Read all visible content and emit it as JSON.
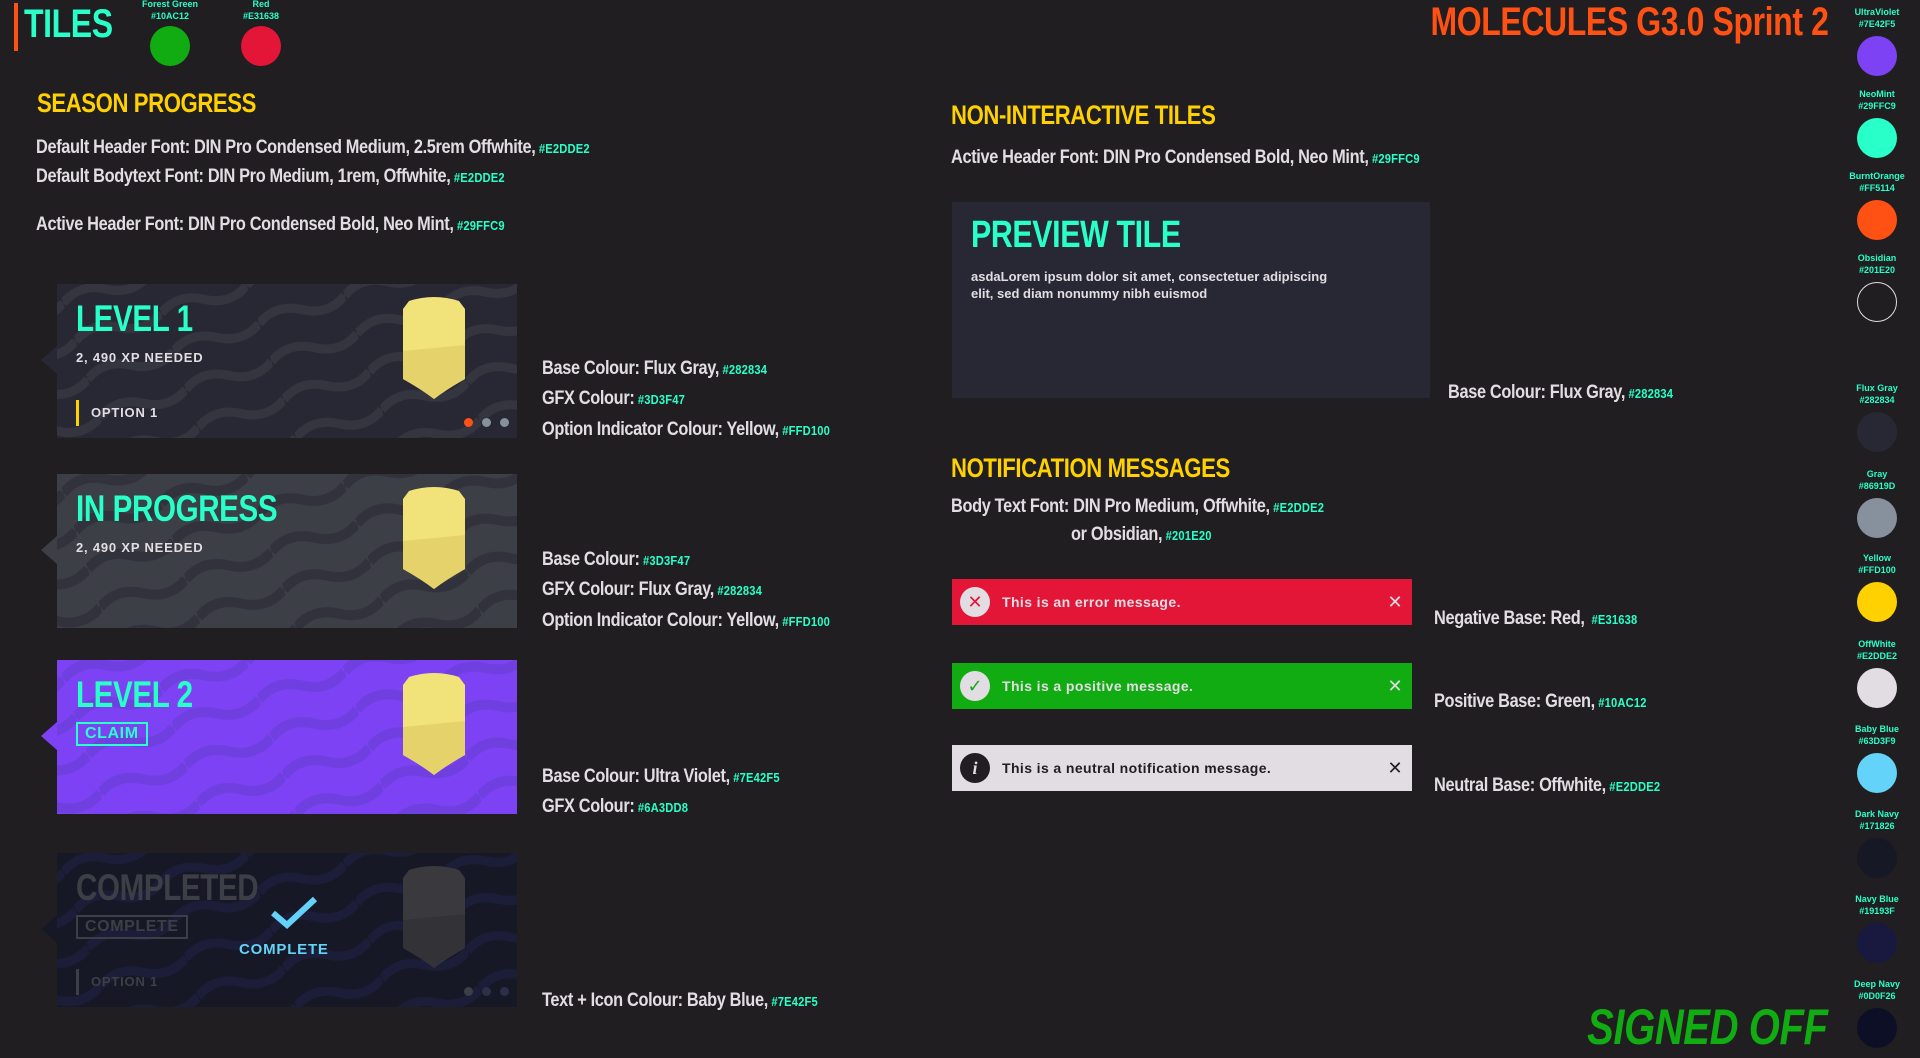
{
  "header": {
    "title": "TILES",
    "sprint": "MOLECULES G3.0 Sprint 2",
    "signed_off": "SIGNED OFF"
  },
  "top_swatches": [
    {
      "name": "Forest Green",
      "hex": "#10AC12",
      "color": "#10AC12"
    },
    {
      "name": "Red",
      "hex": "#E31638",
      "color": "#E31638"
    }
  ],
  "palette": [
    {
      "name": "UltraViolet",
      "hex": "#7E42F5",
      "color": "#7E42F5"
    },
    {
      "name": "NeoMint",
      "hex": "#29FFC9",
      "color": "#29FFC9"
    },
    {
      "name": "BurntOrange",
      "hex": "#FF5114",
      "color": "#FF5114"
    },
    {
      "name": "Obsidian",
      "hex": "#201E20",
      "color": "#201E20"
    },
    {
      "name": "Flux Gray",
      "hex": "#282834",
      "color": "#282834"
    },
    {
      "name": "Gray",
      "hex": "#86919D",
      "color": "#86919D"
    },
    {
      "name": "Yellow",
      "hex": "#FFD100",
      "color": "#FFD100"
    },
    {
      "name": "OffWhite",
      "hex": "#E2DDE2",
      "color": "#E2DDE2"
    },
    {
      "name": "Baby Blue",
      "hex": "#63D3F9",
      "color": "#63D3F9"
    },
    {
      "name": "Dark Navy",
      "hex": "#171826",
      "color": "#171826"
    },
    {
      "name": "Navy Blue",
      "hex": "#19193F",
      "color": "#19193F"
    },
    {
      "name": "Deep Navy",
      "hex": "#0D0F26",
      "color": "#0D0F26"
    }
  ],
  "season": {
    "title": "SEASON PROGRESS",
    "header_font": "Default Header Font: DIN Pro Condensed Medium, 2.5rem Offwhite,",
    "header_font_hex": "#E2DDE2",
    "body_font": "Default Bodytext Font: DIN Pro Medium, 1rem, Offwhite,",
    "body_font_hex": "#E2DDE2",
    "active_font": "Active Header Font: DIN Pro Condensed Bold, Neo Mint,",
    "active_font_hex": "#29FFC9"
  },
  "tiles": {
    "level1": {
      "title": "LEVEL 1",
      "sub": "2, 490 XP NEEDED",
      "option": "OPTION 1",
      "spec": [
        {
          "label": "Base Colour: Flux Gray,",
          "hex": "#282834"
        },
        {
          "label": "GFX Colour:",
          "hex": "#3D3F47"
        },
        {
          "label": "Option Indicator Colour: Yellow,",
          "hex": "#FFD100"
        }
      ]
    },
    "progress": {
      "title": "IN PROGRESS",
      "sub": "2, 490 XP NEEDED",
      "spec": [
        {
          "label": "Base Colour:",
          "hex": "#3D3F47"
        },
        {
          "label": "GFX Colour: Flux Gray,",
          "hex": "#282834"
        },
        {
          "label": "Option Indicator Colour: Yellow,",
          "hex": "#FFD100"
        }
      ]
    },
    "level2": {
      "title": "LEVEL 2",
      "badge": "CLAIM",
      "spec": [
        {
          "label": "Base Colour: Ultra Violet,",
          "hex": "#7E42F5"
        },
        {
          "label": "GFX Colour:",
          "hex": "#6A3DD8"
        }
      ]
    },
    "completed": {
      "title": "COMPLETED",
      "badge": "COMPLETE",
      "center_label": "COMPLETE",
      "option": "OPTION 1",
      "spec": [
        {
          "label": "Text + Icon Colour: Baby Blue,",
          "hex": "#7E42F5"
        }
      ]
    }
  },
  "non_interactive": {
    "title": "NON-INTERACTIVE TILES",
    "active_font": "Active Header Font: DIN Pro Condensed Bold, Neo Mint,",
    "active_font_hex": "#29FFC9",
    "preview_title": "PREVIEW TILE",
    "preview_body": "asdaLorem ipsum dolor sit amet, consectetuer adipiscing elit, sed diam nonummy nibh euismod",
    "base": "Base Colour: Flux Gray,",
    "base_hex": "#282834"
  },
  "notifications": {
    "title": "NOTIFICATION MESSAGES",
    "body_font": "Body Text Font: DIN Pro Medium, Offwhite,",
    "body_font_hex": "#E2DDE2",
    "or_obsidian": "or Obsidian,",
    "or_obsidian_hex": "#201E20",
    "error": {
      "text": "This is an error message.",
      "desc": "Negative Base: Red,",
      "hex": "#E31638"
    },
    "positive": {
      "text": "This is a positive message.",
      "desc": "Positive Base: Green,",
      "hex": "#10AC12"
    },
    "neutral": {
      "text": "This is a neutral notification message.",
      "desc": "Neutral Base: Offwhite,",
      "hex": "#E2DDE2"
    },
    "close": "✕"
  }
}
